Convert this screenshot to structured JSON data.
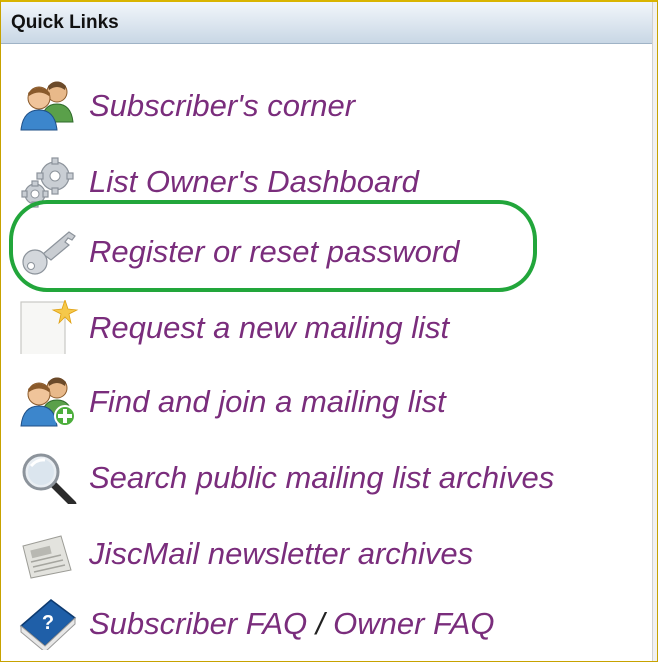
{
  "panel": {
    "title": "Quick Links"
  },
  "links": [
    {
      "label": "Subscriber's corner",
      "icon": "users-icon"
    },
    {
      "label": "List Owner's Dashboard",
      "icon": "gears-icon"
    },
    {
      "label": "Register or reset password",
      "icon": "key-icon"
    },
    {
      "label": "Request a new mailing list",
      "icon": "new-document-icon"
    },
    {
      "label": "Find and join a mailing list",
      "icon": "add-users-icon"
    },
    {
      "label": "Search public mailing list archives",
      "icon": "magnifier-icon"
    },
    {
      "label": "JiscMail newsletter archives",
      "icon": "newspaper-icon"
    },
    {
      "label_a": "Subscriber FAQ",
      "separator": "/",
      "label_b": "Owner FAQ",
      "icon": "help-book-icon"
    }
  ],
  "colors": {
    "link": "#7a2d7c",
    "highlight": "#22a63b",
    "header_text": "#111111"
  }
}
